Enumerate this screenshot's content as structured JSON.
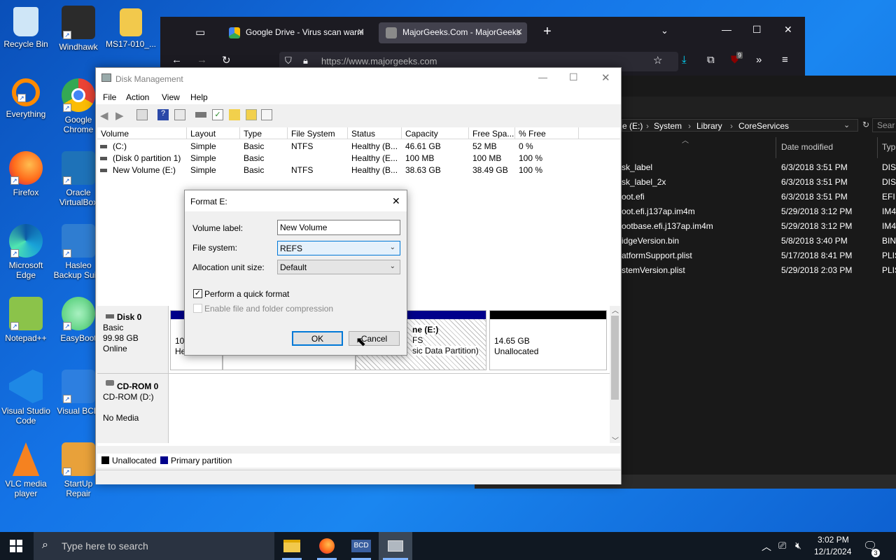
{
  "desktop": {
    "icons": [
      {
        "label": "Recycle Bin",
        "icon": "recycle-bin-icon",
        "color": "#cfe6f7"
      },
      {
        "label": "Windhawk",
        "icon": "windhawk-icon",
        "color": "#2b2b2b"
      },
      {
        "label": "MS17-010_...",
        "icon": "folder-icon",
        "color": "#f2c94c"
      },
      {
        "label": "Everything",
        "icon": "everything-icon",
        "color": "#ff8a00"
      },
      {
        "label": "Google Chrome",
        "icon": "chrome-icon",
        "color": "#34a853"
      },
      {
        "label": "Firefox",
        "icon": "firefox-icon",
        "color": "#ff6a1a"
      },
      {
        "label": "Oracle VirtualBox",
        "icon": "virtualbox-icon",
        "color": "#1e72b8"
      },
      {
        "label": "Microsoft Edge",
        "icon": "edge-icon",
        "color": "#19a3d8"
      },
      {
        "label": "Hasleo Backup Sui...",
        "icon": "hasleo-icon",
        "color": "#2f7dd1"
      },
      {
        "label": "Notepad++",
        "icon": "notepadpp-icon",
        "color": "#8bc34a"
      },
      {
        "label": "EasyBoot",
        "icon": "easyboot-icon",
        "color": "#43c86b"
      },
      {
        "label": "Visual Studio Code",
        "icon": "vscode-icon",
        "color": "#1e88e5"
      },
      {
        "label": "Visual BCD",
        "icon": "visualbcd-icon",
        "color": "#2d7fe0"
      },
      {
        "label": "VLC media player",
        "icon": "vlc-icon",
        "color": "#f58220"
      },
      {
        "label": "StartUp Repair",
        "icon": "startup-repair-icon",
        "color": "#e8a13a"
      }
    ]
  },
  "browser": {
    "tabs": [
      {
        "label": "Google Drive - Virus scan warni",
        "icon": "google-drive-icon"
      },
      {
        "label": "MajorGeeks.Com - MajorGeeks",
        "icon": "majorgeeks-icon"
      }
    ],
    "new_tab": "+",
    "url": "https://www.majorgeeks.com",
    "badge": "9"
  },
  "explorer": {
    "breadcrumb": [
      "e (E:)",
      "System",
      "Library",
      "CoreServices"
    ],
    "search_placeholder": "Sear",
    "columns": [
      "Date modified",
      "Typ"
    ],
    "files": [
      {
        "name": "sk_label",
        "date": "6/3/2018 3:51 PM",
        "type": "DISK"
      },
      {
        "name": "sk_label_2x",
        "date": "6/3/2018 3:51 PM",
        "type": "DISK"
      },
      {
        "name": "oot.efi",
        "date": "6/3/2018 3:51 PM",
        "type": "EFI F"
      },
      {
        "name": "oot.efi.j137ap.im4m",
        "date": "5/29/2018 3:12 PM",
        "type": "IM4"
      },
      {
        "name": "ootbase.efi.j137ap.im4m",
        "date": "5/29/2018 3:12 PM",
        "type": "IM4"
      },
      {
        "name": "idgeVersion.bin",
        "date": "5/8/2018 3:40 PM",
        "type": "BIN"
      },
      {
        "name": "atformSupport.plist",
        "date": "5/17/2018 8:41 PM",
        "type": "PLIS"
      },
      {
        "name": "stemVersion.plist",
        "date": "5/29/2018 2:03 PM",
        "type": "PLIS"
      }
    ]
  },
  "disk_mgmt": {
    "title": "Disk Management",
    "menu": [
      "File",
      "Action",
      "View",
      "Help"
    ],
    "columns": [
      "Volume",
      "Layout",
      "Type",
      "File System",
      "Status",
      "Capacity",
      "Free Spa...",
      "% Free"
    ],
    "rows": [
      [
        "(C:)",
        "Simple",
        "Basic",
        "NTFS",
        "Healthy (B...",
        "46.61 GB",
        "52 MB",
        "0 %"
      ],
      [
        "(Disk 0 partition 1)",
        "Simple",
        "Basic",
        "",
        "Healthy (E...",
        "100 MB",
        "100 MB",
        "100 %"
      ],
      [
        "New Volume (E:)",
        "Simple",
        "Basic",
        "NTFS",
        "Healthy (B...",
        "38.63 GB",
        "38.49 GB",
        "100 %"
      ]
    ],
    "disk0": {
      "name": "Disk 0",
      "type": "Basic",
      "size": "99.98 GB",
      "state": "Online"
    },
    "partitions": {
      "p1_a": "10",
      "p1_b": "He",
      "e_name": "ne (E:)",
      "e_fs": "FS",
      "e_status": "sic Data Partition)",
      "unalloc_size": "14.65 GB",
      "unalloc_label": "Unallocated"
    },
    "cdrom": {
      "name": "CD-ROM 0",
      "drive": "CD-ROM (D:)",
      "media": "No Media"
    },
    "legend": {
      "unallocated": "Unallocated",
      "primary": "Primary partition"
    },
    "colors": {
      "primary": "#00008b",
      "unallocated": "#000000"
    }
  },
  "format_dialog": {
    "title": "Format E:",
    "volume_label_caption": "Volume label:",
    "volume_label_value": "New Volume",
    "fs_caption": "File system:",
    "fs_value": "REFS",
    "alloc_caption": "Allocation unit size:",
    "alloc_value": "Default",
    "quick_format": "Perform a quick format",
    "compression": "Enable file and folder compression",
    "ok": "OK",
    "cancel": "Cancel"
  },
  "taskbar": {
    "search_placeholder": "Type here to search",
    "bcd_label": "BCD",
    "time": "3:02 PM",
    "date": "12/1/2024",
    "notifications": "3"
  }
}
